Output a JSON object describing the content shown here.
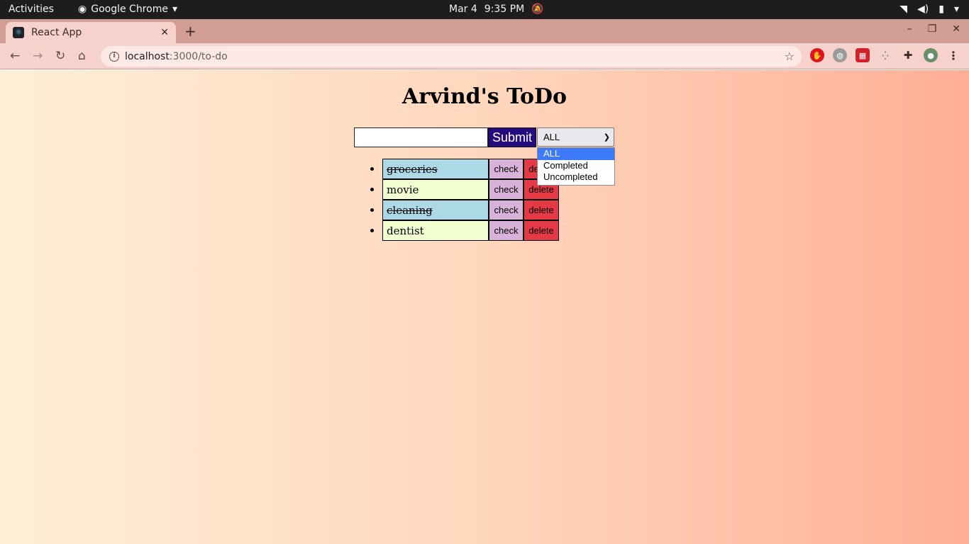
{
  "system_bar": {
    "activities": "Activities",
    "app_name": "Google Chrome",
    "date": "Mar 4",
    "time": "9:35 PM"
  },
  "browser": {
    "tab_title": "React App",
    "url_host": "localhost",
    "url_path": ":3000/to-do"
  },
  "app": {
    "title": "Arvind's ToDo",
    "input_value": "",
    "submit_label": "Submit",
    "filter_selected": "ALL",
    "filter_options": [
      "ALL",
      "Completed",
      "Uncompleted"
    ],
    "todos": [
      {
        "text": "groceries",
        "completed": true,
        "check_label": "check",
        "delete_label": "delete"
      },
      {
        "text": "movie",
        "completed": false,
        "check_label": "check",
        "delete_label": "delete"
      },
      {
        "text": "cleaning",
        "completed": true,
        "check_label": "check",
        "delete_label": "delete"
      },
      {
        "text": "dentist",
        "completed": false,
        "check_label": "check",
        "delete_label": "delete"
      }
    ]
  },
  "colors": {
    "completed_bg": "#add8e6",
    "uncompleted_bg": "#f2ffd0",
    "check_bg": "#d8b2d8",
    "delete_bg": "#e63946",
    "submit_bg": "#260b7f"
  }
}
